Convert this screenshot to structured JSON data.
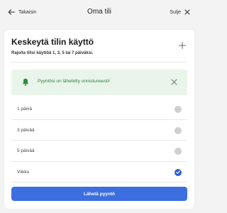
{
  "header": {
    "back_label": "Takaisin",
    "title": "Oma tili",
    "close_label": "Sulje"
  },
  "card": {
    "title": "Keskeytä tilin käyttö",
    "subtitle": "Rajoita tilisi käyttöä 1, 3, 5 tai 7 päiväksi."
  },
  "notice": {
    "message": "Pyyntösi on lähetetty onnistuneesti!",
    "color": "#2d7f3b",
    "background": "#e9f5ea"
  },
  "options": [
    {
      "label": "1 päivä",
      "selected": false
    },
    {
      "label": "3 päivää",
      "selected": false
    },
    {
      "label": "5 päivää",
      "selected": false
    },
    {
      "label": "Viikko",
      "selected": true
    }
  ],
  "submit": {
    "label": "Lähetä pyyntö",
    "color": "#3c6ee0"
  },
  "icons": {
    "back": "arrow-left-icon",
    "close": "close-icon",
    "expand": "plus-icon",
    "notice": "bell-icon",
    "dismiss": "close-icon",
    "selected": "check-icon"
  }
}
